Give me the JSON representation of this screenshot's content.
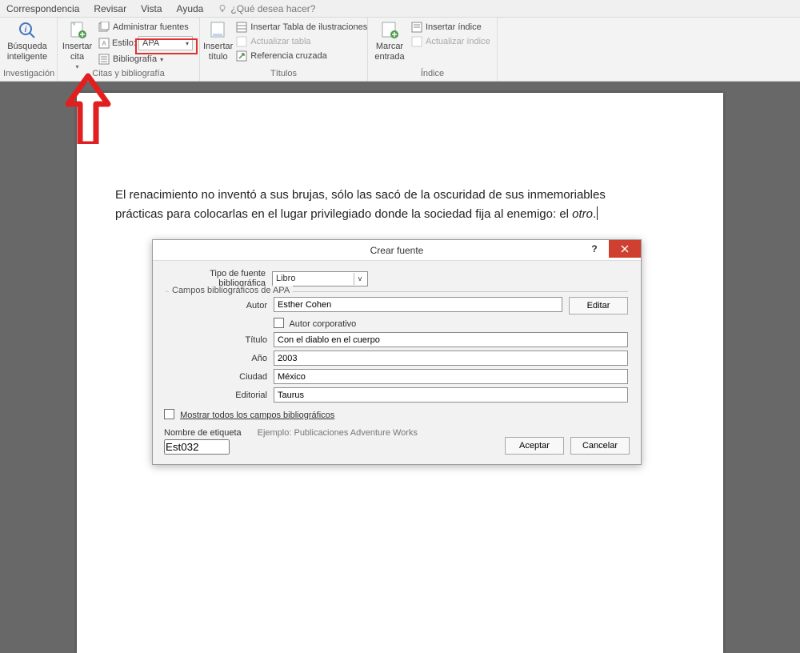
{
  "menubar": {
    "items": [
      "Correspondencia",
      "Revisar",
      "Vista",
      "Ayuda"
    ],
    "tellme": "¿Qué desea hacer?"
  },
  "ribbon": {
    "research": {
      "big": "Búsqueda\ninteligente",
      "group": "Investigación"
    },
    "citas": {
      "big": "Insertar\ncita",
      "manage": "Administrar fuentes",
      "style_label": "Estilo:",
      "style_value": "APA",
      "biblio": "Bibliografía",
      "group": "Citas y bibliografía"
    },
    "titulos": {
      "big": "Insertar\ntítulo",
      "cmds": [
        "Insertar Tabla de ilustraciones",
        "Actualizar tabla",
        "Referencia cruzada"
      ],
      "group": "Títulos"
    },
    "indice": {
      "big": "Marcar\nentrada",
      "cmds": [
        "Insertar índice",
        "Actualizar índice"
      ],
      "group": "Índice"
    }
  },
  "document": {
    "line1": "El renacimiento no inventó a sus brujas, sólo las sacó de la oscuridad de sus inmemoriables",
    "line2a": "prácticas para colocarlas en el lugar privilegiado donde la sociedad fija al enemigo: el ",
    "line2b": "otro",
    "line2c": "."
  },
  "dialog": {
    "title": "Crear fuente",
    "type_label": "Tipo de fuente bibliográfica",
    "type_value": "Libro",
    "fieldset": "Campos bibliográficos de APA",
    "author_label": "Autor",
    "author_value": "Esther Cohen",
    "edit_btn": "Editar",
    "corp_label": "Autor corporativo",
    "title_label": "Título",
    "title_value": "Con el diablo en el cuerpo",
    "year_label": "Año",
    "year_value": "2003",
    "city_label": "Ciudad",
    "city_value": "México",
    "publisher_label": "Editorial",
    "publisher_value": "Taurus",
    "showall": "Mostrar todos los campos bibliográficos",
    "tagname_label": "Nombre de etiqueta",
    "tagname_value": "Est032",
    "example": "Ejemplo: Publicaciones Adventure Works",
    "ok": "Aceptar",
    "cancel": "Cancelar"
  }
}
